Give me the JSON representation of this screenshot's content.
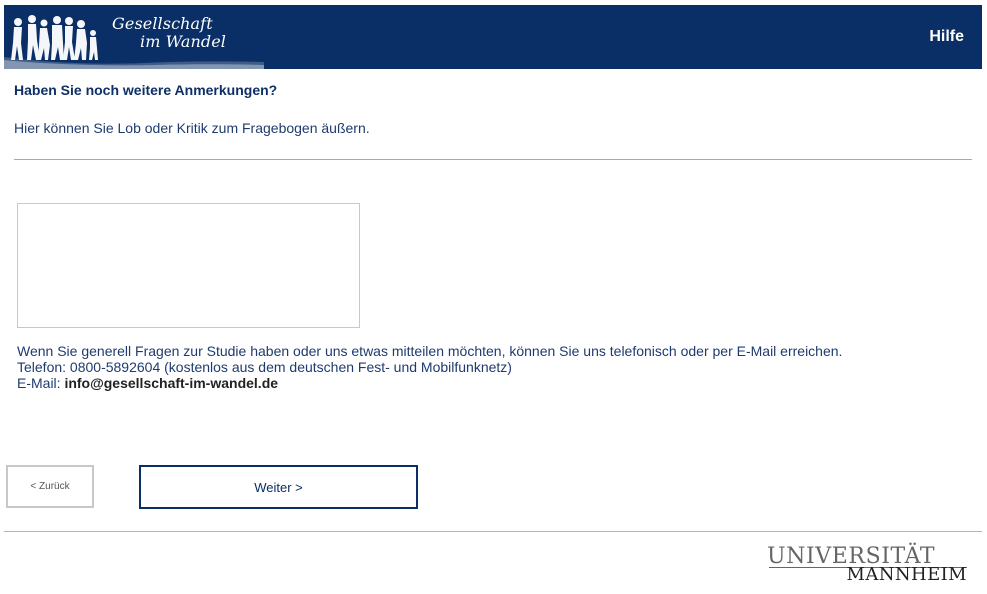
{
  "header": {
    "logo_line1": "Gesellschaft",
    "logo_line2": "im Wandel",
    "help_label": "Hilfe",
    "background_color": "#0a2f66"
  },
  "question": {
    "title": "Haben Sie noch weitere Anmerkungen?",
    "description": "Hier können Sie Lob oder Kritik zum Fragebogen äußern.",
    "comment_value": ""
  },
  "contact": {
    "line1": "Wenn Sie generell Fragen zur Studie haben oder uns etwas mitteilen möchten, können Sie uns telefonisch oder per E-Mail erreichen.",
    "line2": "Telefon: 0800-5892604 (kostenlos aus dem deutschen Fest- und Mobilfunknetz)",
    "email_label": "E-Mail: ",
    "email_value": "info@gesellschaft-im-wandel.de"
  },
  "navigation": {
    "back_label": "< Zurück",
    "next_label": "Weiter >"
  },
  "footer": {
    "university_top": "UNIVERSITÄT",
    "university_bottom": "MANNHEIM"
  },
  "icons": {
    "header_logo": "people-silhouette-icon",
    "textarea_resize": "resize-handle-icon"
  }
}
